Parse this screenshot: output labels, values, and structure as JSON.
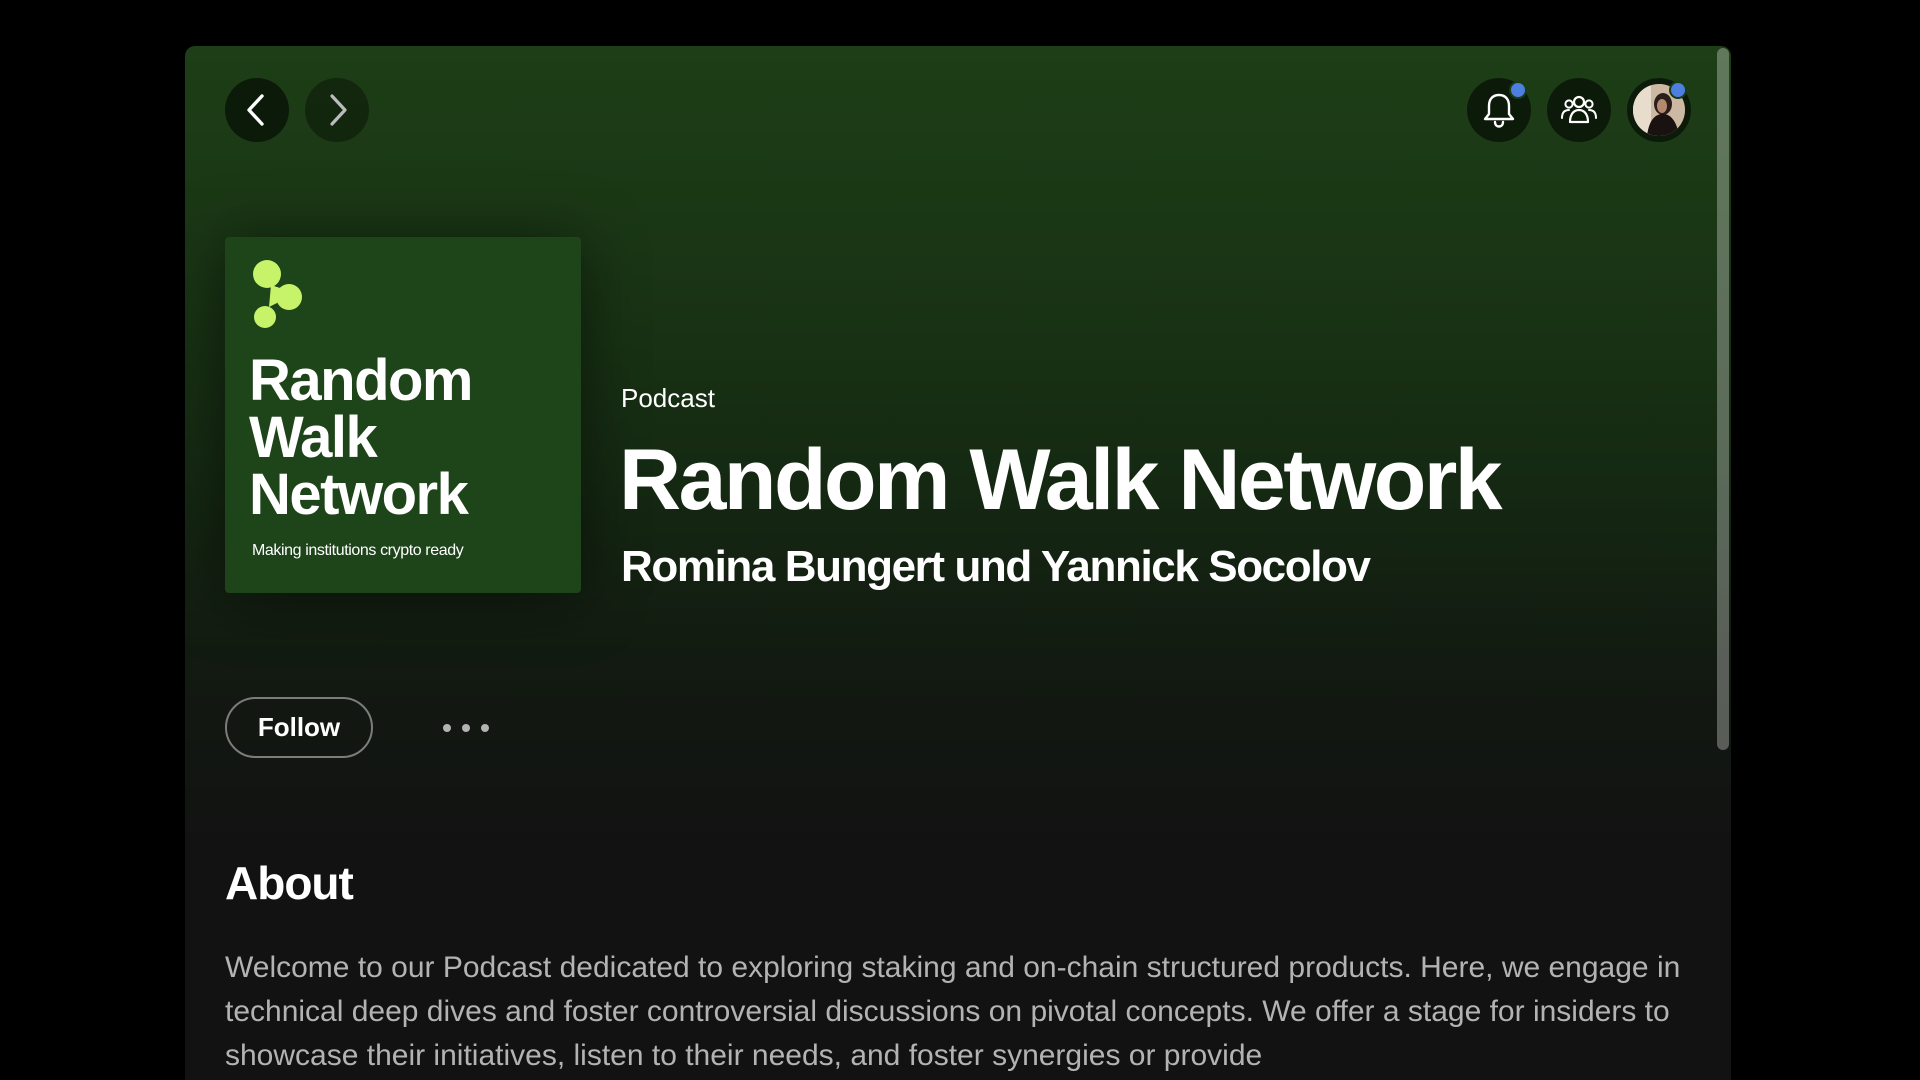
{
  "nav": {
    "back_icon": "chevron-left-icon",
    "forward_icon": "chevron-right-icon"
  },
  "top_right": {
    "notifications_icon": "bell-icon",
    "friends_icon": "friends-activity-icon",
    "avatar_icon": "user-avatar",
    "badge_color": "#4d7fe0"
  },
  "cover": {
    "title_lines": [
      "Random",
      "Walk",
      "Network"
    ],
    "tagline": "Making institutions crypto ready",
    "logo_icon": "random-walk-logo",
    "background_color": "#1e4419",
    "logo_color": "#c6f36a"
  },
  "header": {
    "type": "Podcast",
    "title": "Random Walk Network",
    "authors": "Romina Bungert und Yannick Socolov"
  },
  "actions": {
    "follow_label": "Follow",
    "more_icon": "more-options-icon"
  },
  "about": {
    "heading": "About",
    "text": "Welcome to our Podcast dedicated to exploring staking and on-chain structured products. Here, we engage in technical deep dives and foster controversial discussions on pivotal concepts. We offer a stage for insiders to showcase their initiatives, listen to their needs, and foster synergies or provide"
  },
  "colors": {
    "page_background": "#000000",
    "panel_top": "#1d3e16",
    "panel_bottom": "#121212",
    "text_primary": "#ffffff",
    "text_secondary": "#b3b3b3"
  }
}
